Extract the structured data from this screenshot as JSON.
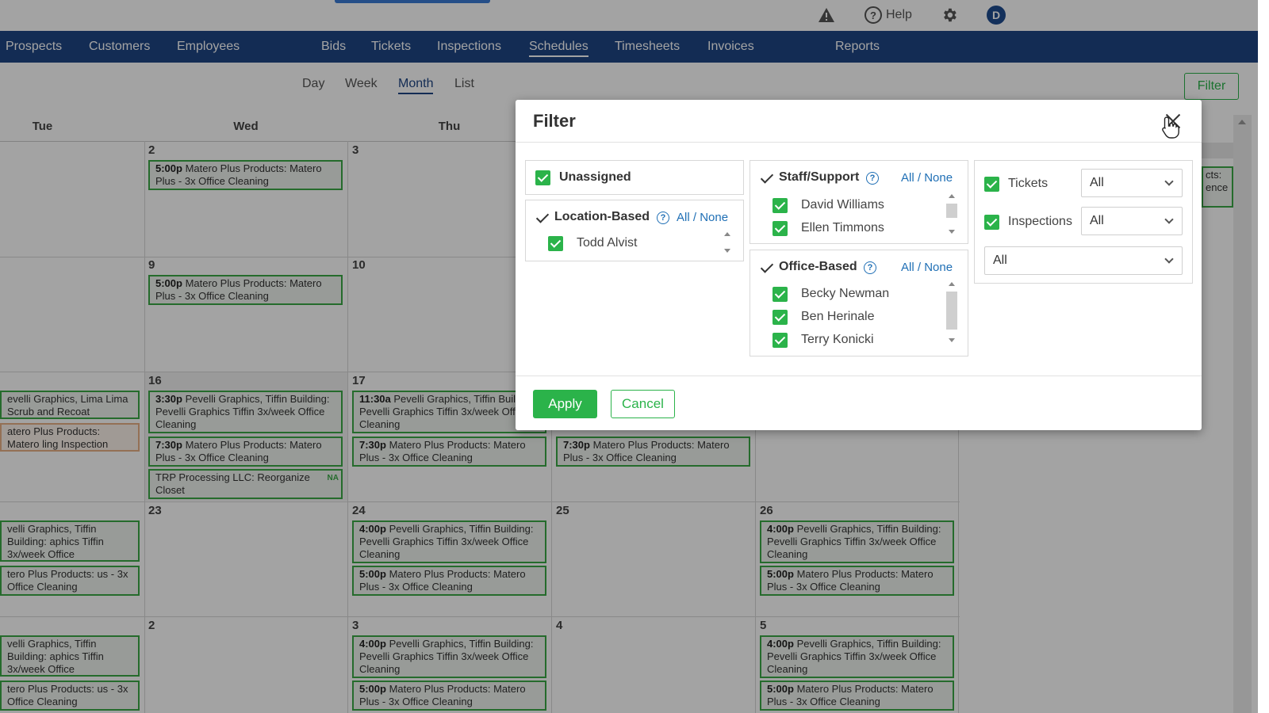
{
  "topbar": {
    "warning_icon": "warning-icon",
    "help_label": "Help",
    "settings_icon": "gear-icon",
    "avatar_initial": "D"
  },
  "nav": {
    "items": [
      "Prospects",
      "Customers",
      "Employees",
      "Bids",
      "Tickets",
      "Inspections",
      "Schedules",
      "Timesheets",
      "Invoices",
      "Reports"
    ],
    "active": "Schedules"
  },
  "views": {
    "items": [
      "Day",
      "Week",
      "Month",
      "List"
    ],
    "active": "Month",
    "filter_label": "Filter"
  },
  "calendar": {
    "weekdays": [
      "Tue",
      "Wed",
      "Thu"
    ],
    "day_numbers": [
      "2",
      "3",
      "9",
      "10",
      "16",
      "17",
      "23",
      "24",
      "25",
      "26",
      "2",
      "3",
      "4",
      "5"
    ],
    "events": [
      {
        "time": "5:00p",
        "text": "Matero Plus Products: Matero Plus - 3x Office Cleaning"
      },
      {
        "time": "5:00p",
        "text": "Matero Plus Products: Matero Plus - 3x Office Cleaning"
      },
      {
        "time": "",
        "text": "evelli Graphics, Lima Lima Scrub and Recoat"
      },
      {
        "time": "",
        "text": "atero Plus Products: Matero ling Inspection"
      },
      {
        "time": "3:30p",
        "text": "Pevelli Graphics, Tiffin Building: Pevelli Graphics Tiffin 3x/week Office Cleaning"
      },
      {
        "time": "7:30p",
        "text": "Matero Plus Products: Matero Plus - 3x Office Cleaning"
      },
      {
        "time": "",
        "text": "TRP Processing LLC: Reorganize Closet",
        "badge": "NA"
      },
      {
        "time": "11:30a",
        "text": "Pevelli Graphics, Tiffin Building: Pevelli Graphics Tiffin 3x/week Office Cleaning"
      },
      {
        "time": "7:30p",
        "text": "Matero Plus Products: Matero Plus - 3x Office Cleaning"
      },
      {
        "time": "7:30p",
        "text": "Matero Plus Products: Matero Plus - 3x Office Cleaning"
      },
      {
        "time": "",
        "text": "velli Graphics, Tiffin Building: aphics Tiffin 3x/week Office"
      },
      {
        "time": "",
        "text": "tero Plus Products: us - 3x Office Cleaning"
      },
      {
        "time": "4:00p",
        "text": "Pevelli Graphics, Tiffin Building: Pevelli Graphics Tiffin 3x/week Office Cleaning"
      },
      {
        "time": "5:00p",
        "text": "Matero Plus Products: Matero Plus - 3x Office Cleaning"
      },
      {
        "time": "4:00p",
        "text": "Pevelli Graphics, Tiffin Building: Pevelli Graphics Tiffin 3x/week Office Cleaning"
      },
      {
        "time": "5:00p",
        "text": "Matero Plus Products: Matero Plus - 3x Office Cleaning"
      },
      {
        "time": "",
        "text": "velli Graphics, Tiffin Building: aphics Tiffin 3x/week Office"
      },
      {
        "time": "",
        "text": "tero Plus Products: us - 3x Office Cleaning"
      },
      {
        "time": "4:00p",
        "text": "Pevelli Graphics, Tiffin Building: Pevelli Graphics Tiffin 3x/week Office Cleaning"
      },
      {
        "time": "5:00p",
        "text": "Matero Plus Products: Matero Plus - 3x Office Cleaning"
      },
      {
        "time": "4:00p",
        "text": "Pevelli Graphics, Tiffin Building: Pevelli Graphics Tiffin 3x/week Office Cleaning"
      },
      {
        "time": "5:00p",
        "text": "Matero Plus Products: Matero Plus - 3x Office Cleaning"
      },
      {
        "time": "",
        "text": "cts: ence"
      }
    ]
  },
  "modal": {
    "title": "Filter",
    "unassigned_label": "Unassigned",
    "all_label": "All",
    "slash": "/",
    "none_label": "None",
    "location_based": {
      "label": "Location-Based",
      "members": [
        "Todd Alvist"
      ]
    },
    "staff_support": {
      "label": "Staff/Support",
      "members": [
        "David Williams",
        "Ellen Timmons"
      ]
    },
    "office_based": {
      "label": "Office-Based",
      "members": [
        "Becky Newman",
        "Ben Herinale",
        "Terry Konicki"
      ]
    },
    "types": [
      {
        "label": "Tickets",
        "selected": "All"
      },
      {
        "label": "Inspections",
        "selected": "All"
      }
    ],
    "extra_select": "All",
    "apply_label": "Apply",
    "cancel_label": "Cancel"
  },
  "colors": {
    "nav": "#1f4584",
    "accent_green": "#2bb34a",
    "link_blue": "#1f6fb5"
  }
}
